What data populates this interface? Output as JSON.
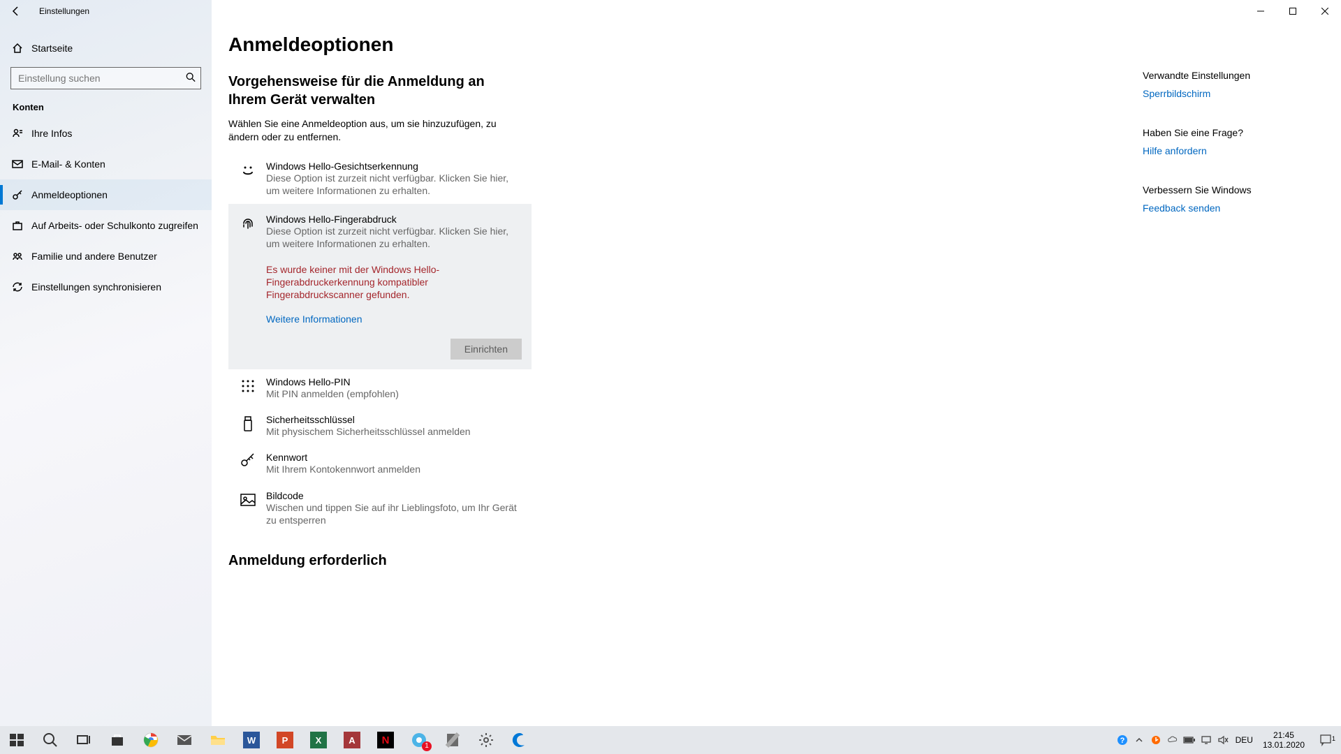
{
  "window": {
    "title": "Einstellungen"
  },
  "home_label": "Startseite",
  "search": {
    "placeholder": "Einstellung suchen"
  },
  "category_title": "Konten",
  "nav": [
    {
      "label": "Ihre Infos"
    },
    {
      "label": "E-Mail- & Konten"
    },
    {
      "label": "Anmeldeoptionen"
    },
    {
      "label": "Auf Arbeits- oder Schulkonto zugreifen"
    },
    {
      "label": "Familie und andere Benutzer"
    },
    {
      "label": "Einstellungen synchronisieren"
    }
  ],
  "page": {
    "title": "Anmeldeoptionen",
    "section1_title": "Vorgehensweise für die Anmeldung an Ihrem Gerät verwalten",
    "section1_desc": "Wählen Sie eine Anmeldeoption aus, um sie hinzuzufügen, zu ändern oder zu entfernen.",
    "options": [
      {
        "title": "Windows Hello-Gesichtserkennung",
        "desc": "Diese Option ist zurzeit nicht verfügbar. Klicken Sie hier, um weitere Informationen zu erhalten."
      },
      {
        "title": "Windows Hello-Fingerabdruck",
        "desc": "Diese Option ist zurzeit nicht verfügbar. Klicken Sie hier, um weitere Informationen zu erhalten.",
        "error": "Es wurde keiner mit der Windows Hello-Fingerabdruckerkennung kompatibler Fingerabdruckscanner gefunden.",
        "link": "Weitere Informationen",
        "button": "Einrichten"
      },
      {
        "title": "Windows Hello-PIN",
        "desc": "Mit PIN anmelden (empfohlen)"
      },
      {
        "title": "Sicherheitsschlüssel",
        "desc": "Mit physischem Sicherheitsschlüssel anmelden"
      },
      {
        "title": "Kennwort",
        "desc": "Mit Ihrem Kontokennwort anmelden"
      },
      {
        "title": "Bildcode",
        "desc": "Wischen und tippen Sie auf ihr Lieblingsfoto, um Ihr Gerät zu entsperren"
      }
    ],
    "section2_title": "Anmeldung erforderlich"
  },
  "rail": {
    "related_title": "Verwandte Einstellungen",
    "related_link": "Sperrbildschirm",
    "question_title": "Haben Sie eine Frage?",
    "question_link": "Hilfe anfordern",
    "improve_title": "Verbessern Sie Windows",
    "improve_link": "Feedback senden"
  },
  "taskbar": {
    "lang": "DEU",
    "time": "21:45",
    "date": "13.01.2020",
    "notif_count": "1"
  }
}
